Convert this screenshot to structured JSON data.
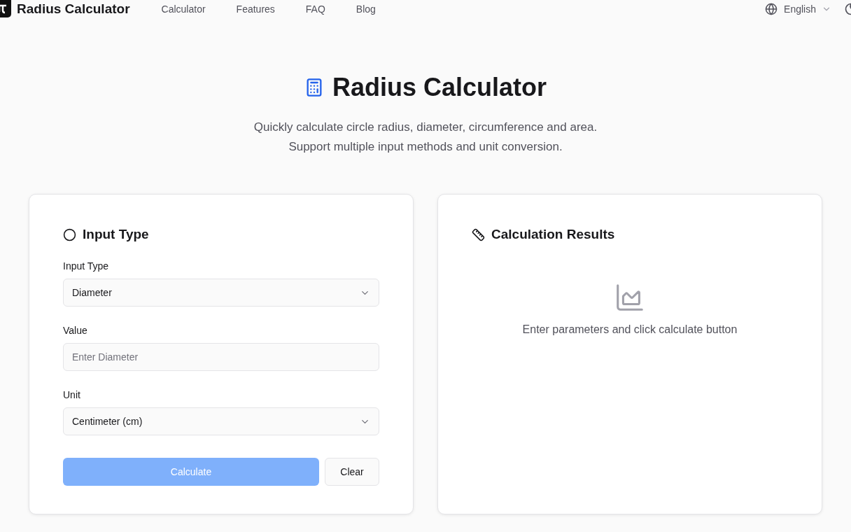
{
  "header": {
    "brand": "Radius Calculator",
    "nav": [
      {
        "label": "Calculator"
      },
      {
        "label": "Features"
      },
      {
        "label": "FAQ"
      },
      {
        "label": "Blog"
      }
    ],
    "language": "English"
  },
  "hero": {
    "title": "Radius Calculator",
    "subtitle_lines": [
      "Quickly calculate circle radius, diameter, circumference and area.",
      "Support multiple input methods and unit conversion."
    ]
  },
  "input_card": {
    "title": "Input Type",
    "fields": [
      {
        "kind": "select",
        "label": "Input Type",
        "value": "Diameter"
      },
      {
        "kind": "input",
        "label": "Value",
        "placeholder": "Enter Diameter"
      },
      {
        "kind": "select",
        "label": "Unit",
        "value": "Centimeter (cm)"
      }
    ],
    "calculate": {
      "label": "Calculate",
      "disabled": true
    },
    "clear": {
      "label": "Clear"
    }
  },
  "results_card": {
    "title": "Calculation Results",
    "empty_message": "Enter parameters and click calculate button"
  }
}
